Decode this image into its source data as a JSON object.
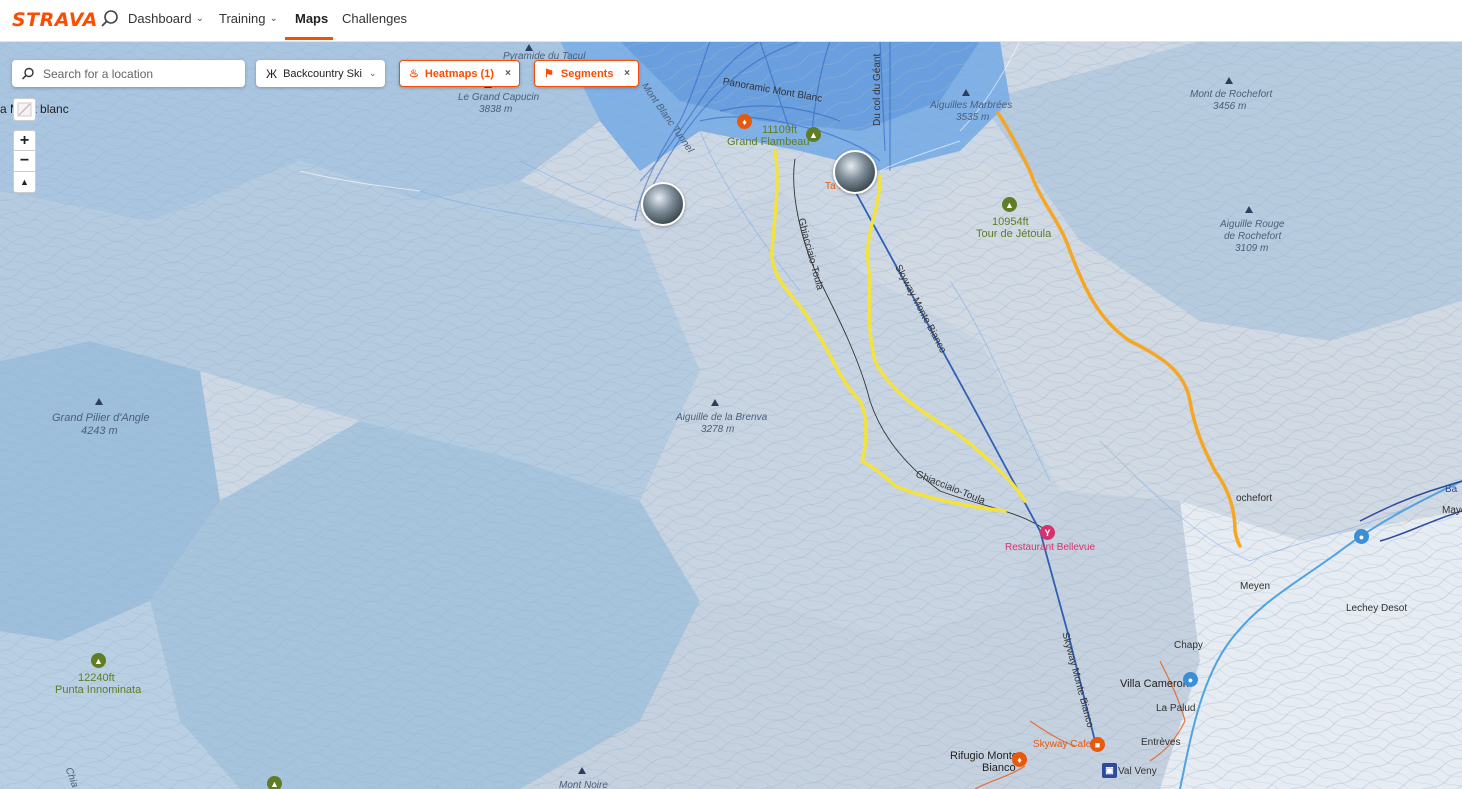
{
  "header": {
    "logo": "STRAVA",
    "nav": [
      "Dashboard",
      "Training",
      "Maps",
      "Challenges"
    ]
  },
  "search": {
    "placeholder": "Search for a location"
  },
  "filters": {
    "sport": "Backcountry Ski",
    "heatmaps": "Heatmaps (1)",
    "segments": "Segments",
    "close": "×"
  },
  "map_controls": {
    "zoom_in": "+",
    "zoom_out": "−",
    "compass": "▲"
  },
  "colors": {
    "accent": "#fc4c02",
    "segment_yellow": "#f4e33c",
    "segment_orange": "#f5a623",
    "lift_blue": "#2f5fb4",
    "poi_pink": "#d6336c"
  },
  "labels": {
    "partial_left": "a Mont blanc",
    "pyramide": "Pyramide du Tacul",
    "grand_capucin_name": "Le Grand Capucin",
    "grand_capucin_elev": "3838 m",
    "mont_blanc_tunnel": "Mont Blanc Tunnel",
    "panoramic": "Panoramic Mont Blanc",
    "col_geant": "Du col du Géant",
    "elev_11109": "11109ft",
    "grand_flambeau": "Grand Flambeau",
    "torino": "Ta    da",
    "aig_marbrees_name": "Aiguilles Marbrées",
    "aig_marbrees_elev": "3535 m",
    "mont_rochefort_name": "Mont de Rochefort",
    "mont_rochefort_elev": "3456 m",
    "jetoula_elev": "10954ft",
    "jetoula_name": "Tour de Jétoula",
    "aig_rouge_1": "Aiguille Rouge",
    "aig_rouge_2": "de Rochefort",
    "aig_rouge_elev": "3109 m",
    "ghiacciaio_1": "Ghiacciaio-Toula",
    "ghiacciaio_2": "Ghiacciaio-Toula",
    "skyway_1": "Skyway Monte Bianco",
    "skyway_2": "Skyway Monte Bianco",
    "grand_pilier_name": "Grand Pilier d'Angle",
    "grand_pilier_elev": "4243 m",
    "brenva_name": "Aiguille de la Brenva",
    "brenva_elev": "3278 m",
    "restaurant": "Restaurant Bellevue",
    "rochefort_partial": "ochefort",
    "meyen": "Meyen",
    "lechey": "Lechey Desot",
    "chapy": "Chapy",
    "villa_cameron": "Villa Cameron",
    "la_palud": "La Palud",
    "entreves": "Entrèves",
    "skyway_cafe": "Skyway Cafe",
    "rifugio_1": "Rifugio Monte",
    "rifugio_2": "Bianco",
    "val_veny": "Val Veny",
    "punta_elev": "12240ft",
    "punta_name": "Punta Innominata",
    "mont_noire": "Mont Noire",
    "mayen_partial": "Mayen",
    "ba_partial": "Ba",
    "chi_partial": "Chia"
  }
}
